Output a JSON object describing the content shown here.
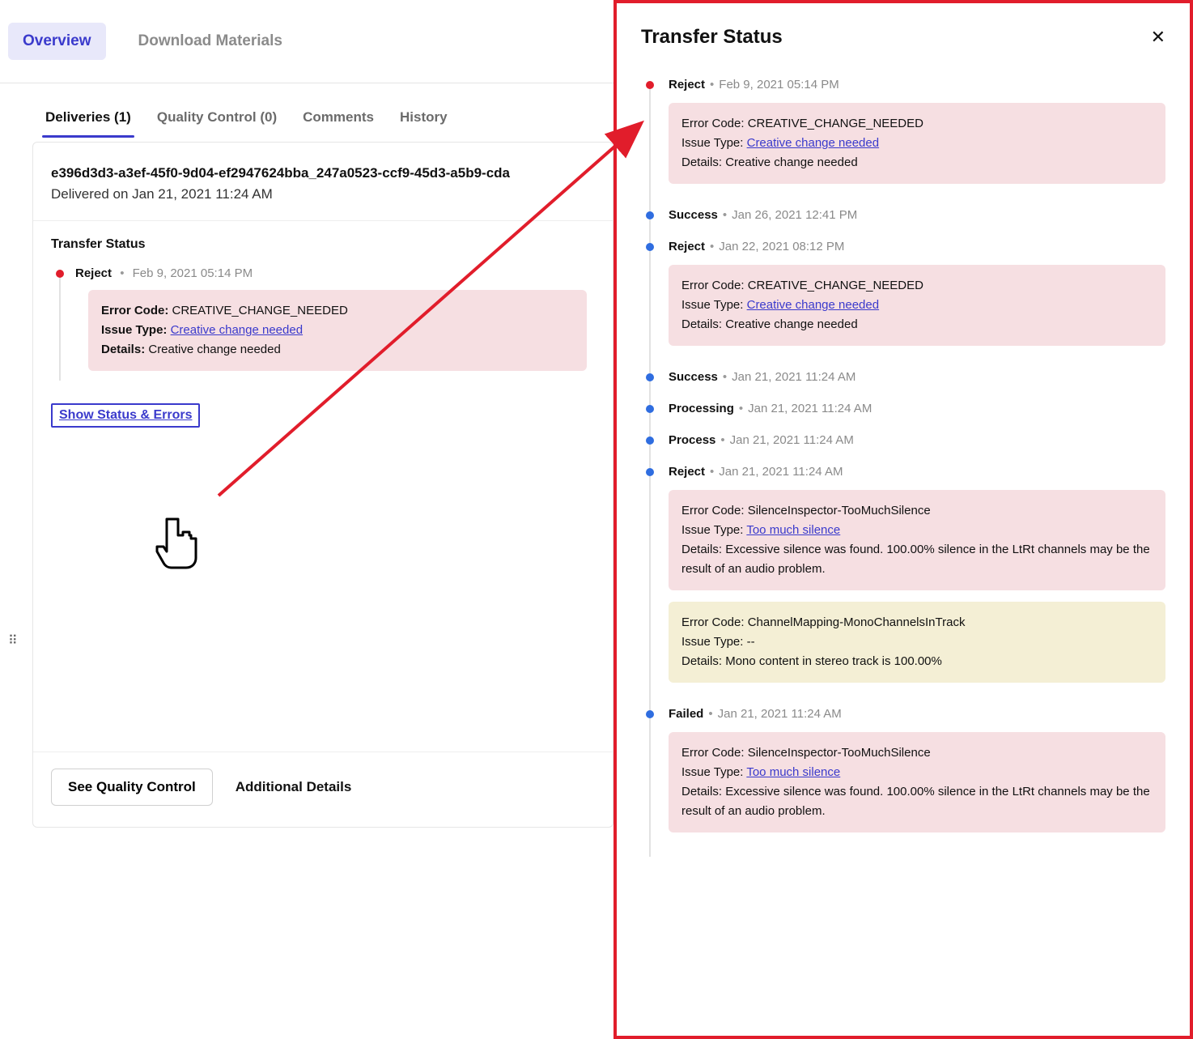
{
  "top_tabs": {
    "overview": "Overview",
    "download": "Download Materials"
  },
  "inner_tabs": {
    "deliveries": "Deliveries (1)",
    "qc": "Quality Control (0)",
    "comments": "Comments",
    "history": "History"
  },
  "delivery": {
    "id": "e396d3d3-a3ef-45f0-9d04-ef2947624bba_247a0523-ccf9-45d3-a5b9-cda",
    "delivered_on": "Delivered on Jan 21, 2021 11:24 AM"
  },
  "card": {
    "ts_title": "Transfer Status",
    "item": {
      "status": "Reject",
      "time": "Feb 9, 2021 05:14 PM",
      "error_code_label": "Error Code:",
      "error_code": "CREATIVE_CHANGE_NEEDED",
      "issue_type_label": "Issue Type:",
      "issue_type_link": "Creative change needed",
      "details_label": "Details:",
      "details": "Creative change needed"
    },
    "show_btn": "Show Status & Errors",
    "see_qc": "See Quality Control",
    "additional": "Additional Details"
  },
  "panel": {
    "title": "Transfer Status",
    "labels": {
      "error_code": "Error Code:",
      "issue_type": "Issue Type:",
      "details": "Details:"
    },
    "items": [
      {
        "dot": "red",
        "status": "Reject",
        "time": "Feb 9, 2021 05:14 PM",
        "errors": [
          {
            "color": "pink",
            "code": "CREATIVE_CHANGE_NEEDED",
            "issue_link": "Creative change needed",
            "details": "Creative change needed"
          }
        ]
      },
      {
        "dot": "blue",
        "status": "Success",
        "time": "Jan 26, 2021 12:41 PM",
        "errors": []
      },
      {
        "dot": "blue",
        "status": "Reject",
        "time": "Jan 22, 2021 08:12 PM",
        "errors": [
          {
            "color": "pink",
            "code": "CREATIVE_CHANGE_NEEDED",
            "issue_link": "Creative change needed",
            "details": "Creative change needed"
          }
        ]
      },
      {
        "dot": "blue",
        "status": "Success",
        "time": "Jan 21, 2021 11:24 AM",
        "errors": []
      },
      {
        "dot": "blue",
        "status": "Processing",
        "time": "Jan 21, 2021 11:24 AM",
        "errors": []
      },
      {
        "dot": "blue",
        "status": "Process",
        "time": "Jan 21, 2021 11:24 AM",
        "errors": []
      },
      {
        "dot": "blue",
        "status": "Reject",
        "time": "Jan 21, 2021 11:24 AM",
        "errors": [
          {
            "color": "pink",
            "code": "SilenceInspector-TooMuchSilence",
            "issue_link": "Too much silence",
            "details": "Excessive silence was found. 100.00% silence in the LtRt channels may be the result of an audio problem."
          },
          {
            "color": "yellow",
            "code": "ChannelMapping-MonoChannelsInTrack",
            "issue_text": "--",
            "details": "Mono content in stereo track is 100.00%"
          }
        ]
      },
      {
        "dot": "blue",
        "status": "Failed",
        "time": "Jan 21, 2021 11:24 AM",
        "errors": [
          {
            "color": "pink",
            "code": "SilenceInspector-TooMuchSilence",
            "issue_link": "Too much silence",
            "details": "Excessive silence was found. 100.00% silence in the LtRt channels may be the result of an audio problem."
          }
        ]
      }
    ]
  }
}
